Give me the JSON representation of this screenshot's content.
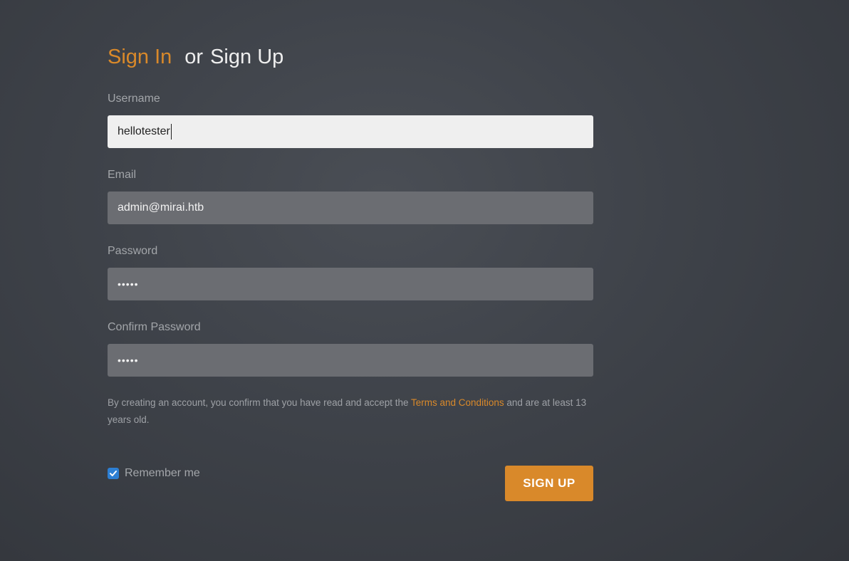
{
  "header": {
    "sign_in_label": "Sign In",
    "or_label": "or",
    "sign_up_label": "Sign Up"
  },
  "form": {
    "username": {
      "label": "Username",
      "value": "hellotester"
    },
    "email": {
      "label": "Email",
      "value": "admin@mirai.htb"
    },
    "password": {
      "label": "Password",
      "value": "•••••"
    },
    "confirm_password": {
      "label": "Confirm Password",
      "value": "•••••"
    }
  },
  "terms": {
    "text_before": "By creating an account, you confirm that you have read and accept the ",
    "link_label": "Terms and Conditions",
    "text_after": " and are at least 13 years old."
  },
  "remember_me": {
    "label": "Remember me",
    "checked": true
  },
  "submit": {
    "label": "SIGN UP"
  },
  "colors": {
    "accent": "#d9892a",
    "checkbox": "#2d7fd3",
    "background": "#3e4249"
  }
}
